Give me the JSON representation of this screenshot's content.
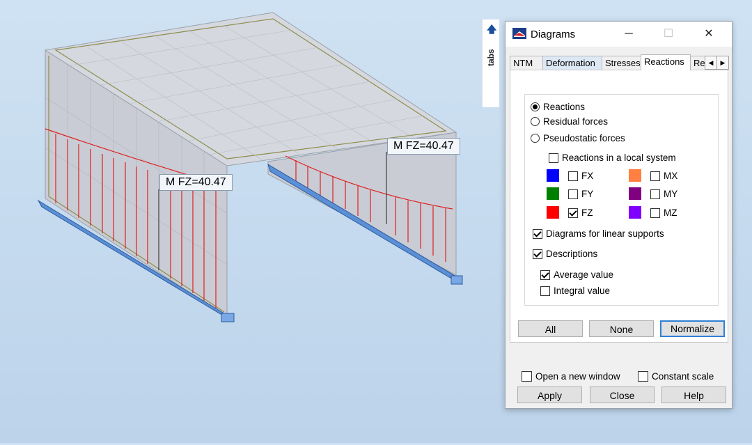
{
  "viewport": {
    "labels": [
      "M  FZ=40.47",
      "M  FZ=40.47"
    ]
  },
  "side_tab": {
    "label": "tabs",
    "arrow": "🡅"
  },
  "dialog": {
    "title": "Diagrams",
    "window_buttons": {
      "minimize": "─",
      "maximize": "☐",
      "close": "✕"
    },
    "tabs": [
      "NTM",
      "Deformation",
      "Stresses",
      "Reactions",
      "Rei"
    ],
    "active_tab": "Reactions",
    "scroll_left": "◀",
    "scroll_right": "▶",
    "radio_options": [
      {
        "label": "Reactions",
        "checked": true
      },
      {
        "label": "Residual forces",
        "checked": false
      },
      {
        "label": "Pseudostatic forces",
        "checked": false
      }
    ],
    "local_system": {
      "label": "Reactions in a local system",
      "checked": false
    },
    "components": [
      {
        "label": "FX",
        "color": "#0000ff",
        "checked": false
      },
      {
        "label": "FY",
        "color": "#008000",
        "checked": false
      },
      {
        "label": "FZ",
        "color": "#ff0000",
        "checked": true
      },
      {
        "label": "MX",
        "color": "#ff8040",
        "checked": false
      },
      {
        "label": "MY",
        "color": "#800080",
        "checked": false
      },
      {
        "label": "MZ",
        "color": "#8000ff",
        "checked": false
      }
    ],
    "linear_supports": {
      "label": "Diagrams for linear supports",
      "checked": true
    },
    "descriptions": {
      "label": "Descriptions",
      "checked": true
    },
    "average_value": {
      "label": "Average value",
      "checked": true
    },
    "integral_value": {
      "label": "Integral value",
      "checked": false
    },
    "buttons": {
      "all": "All",
      "none": "None",
      "normalize": "Normalize"
    },
    "open_new_window": {
      "label": "Open a new window",
      "checked": false
    },
    "constant_scale": {
      "label": "Constant scale",
      "checked": false
    },
    "bottom_buttons": {
      "apply": "Apply",
      "close": "Close",
      "help": "Help"
    }
  }
}
